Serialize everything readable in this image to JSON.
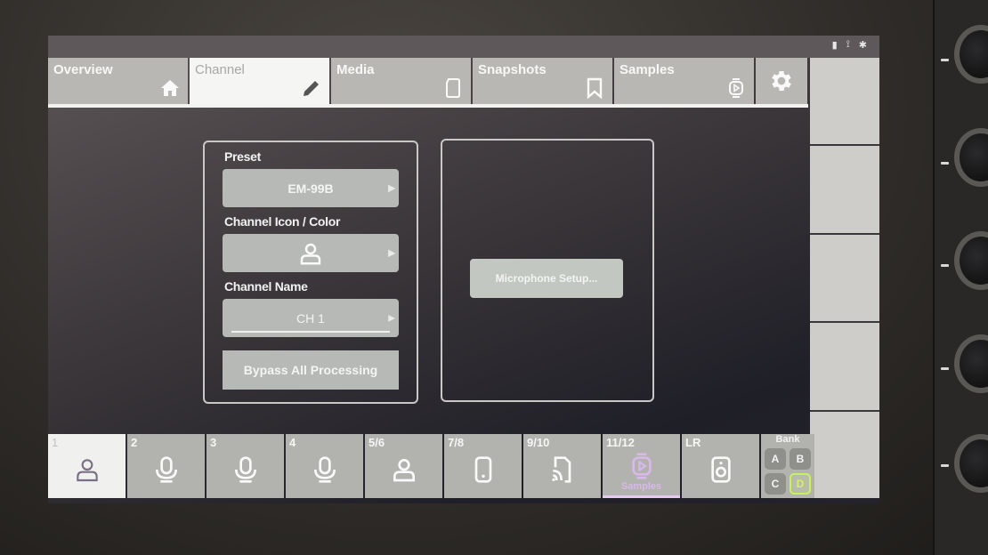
{
  "status_bar": {
    "icons": [
      {
        "name": "sd-card-icon",
        "glyph": "▮"
      },
      {
        "name": "usb-icon",
        "glyph": "⟟"
      },
      {
        "name": "bluetooth-icon",
        "glyph": "✱"
      }
    ]
  },
  "tabs": [
    {
      "label": "Overview",
      "icon": "home-icon",
      "active": false
    },
    {
      "label": "Channel",
      "icon": "pencil-icon",
      "active": true
    },
    {
      "label": "Media",
      "icon": "sd-card-icon",
      "active": false
    },
    {
      "label": "Snapshots",
      "icon": "bookmark-icon",
      "active": false
    },
    {
      "label": "Samples",
      "icon": "samples-watch-icon",
      "active": false
    },
    {
      "label": "",
      "icon": "gear-icon",
      "active": false
    }
  ],
  "channel_panel": {
    "preset_label": "Preset",
    "preset_value": "EM-99B",
    "icon_color_label": "Channel Icon / Color",
    "icon_color_value": "person-icon",
    "name_label": "Channel Name",
    "name_value": "CH 1",
    "bypass_label": "Bypass All Processing",
    "arrow_glyph": "▶"
  },
  "mic_panel": {
    "setup_label": "Microphone Setup..."
  },
  "channels": [
    {
      "num": "1",
      "icon": "person-icon",
      "active": true,
      "sub": ""
    },
    {
      "num": "2",
      "icon": "microphone-icon",
      "active": false,
      "sub": ""
    },
    {
      "num": "3",
      "icon": "microphone-icon",
      "active": false,
      "sub": ""
    },
    {
      "num": "4",
      "icon": "microphone-icon",
      "active": false,
      "sub": ""
    },
    {
      "num": "5/6",
      "icon": "person-icon",
      "active": false,
      "sub": ""
    },
    {
      "num": "7/8",
      "icon": "phone-icon",
      "active": false,
      "sub": ""
    },
    {
      "num": "9/10",
      "icon": "cast-icon",
      "active": false,
      "sub": ""
    },
    {
      "num": "11/12",
      "icon": "samples-watch-icon",
      "active": false,
      "sub": "Samples"
    },
    {
      "num": "LR",
      "icon": "speaker-icon",
      "active": false,
      "sub": ""
    }
  ],
  "bank": {
    "title": "Bank",
    "buttons": [
      "A",
      "B",
      "C",
      "D"
    ],
    "selected": "D"
  },
  "colors": {
    "accent_samples": "#d9b8ea",
    "bank_active": "#c9f060"
  }
}
